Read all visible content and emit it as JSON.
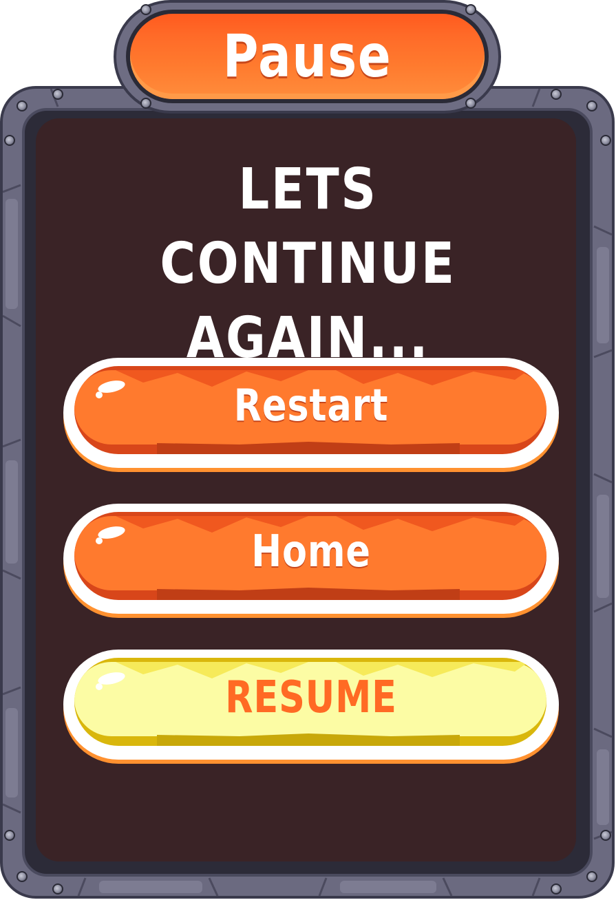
{
  "title": "Pause",
  "subtitle": "Lets continue again...",
  "buttons": {
    "restart": "Restart",
    "home": "Home",
    "resume": "Resume"
  },
  "colors": {
    "panel": "#3a2326",
    "frame": "#6b6a80",
    "orange": "#ff7a2e",
    "orange_dark": "#d8461a",
    "yellow": "#fcfca4",
    "yellow_dark": "#d9b70c",
    "resume_text": "#ff6a24"
  }
}
